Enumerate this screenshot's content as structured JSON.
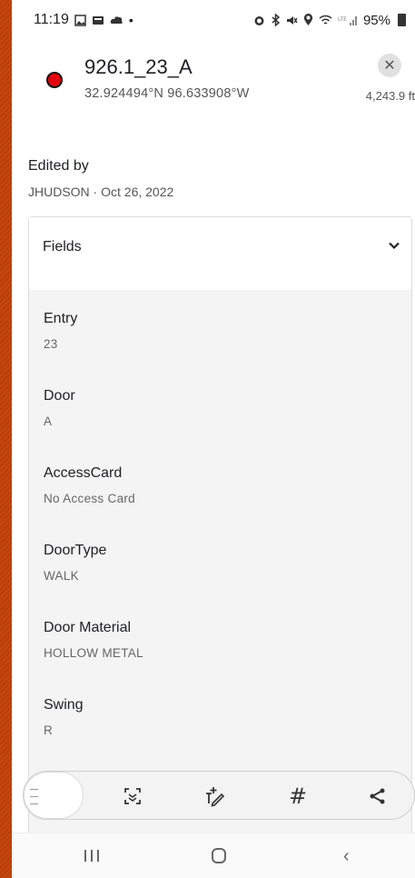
{
  "status_bar": {
    "time": "11:19",
    "battery": "95%",
    "left_icons": [
      "gallery-icon",
      "notification-icon",
      "cloud-icon",
      "dot-icon"
    ],
    "right_icons": [
      "alarm-icon",
      "bluetooth-icon",
      "mute-icon",
      "location-icon",
      "wifi-icon",
      "signal-icon"
    ]
  },
  "feature": {
    "title": "926.1_23_A",
    "coordinates": "32.924494°N 96.633908°W",
    "distance": "4,243.9 ft",
    "marker_color": "#e3000f"
  },
  "edited": {
    "label": "Edited by",
    "value": "JHUDSON · Oct 26, 2022"
  },
  "fields_section": {
    "title": "Fields",
    "fields": [
      {
        "name": "Entry",
        "value": "23"
      },
      {
        "name": "Door",
        "value": "A"
      },
      {
        "name": "AccessCard",
        "value": "No Access Card"
      },
      {
        "name": "DoorType",
        "value": "WALK"
      },
      {
        "name": "Door Material",
        "value": "HOLLOW METAL"
      },
      {
        "name": "Swing",
        "value": "R"
      }
    ]
  },
  "toolbar": {
    "buttons": [
      "scan-icon",
      "edit-geometry-icon",
      "hash-icon",
      "share-icon"
    ],
    "hash_glyph": "#"
  },
  "colors": {
    "accent_background": "#c4470f",
    "card_body": "#f4f4f4"
  }
}
